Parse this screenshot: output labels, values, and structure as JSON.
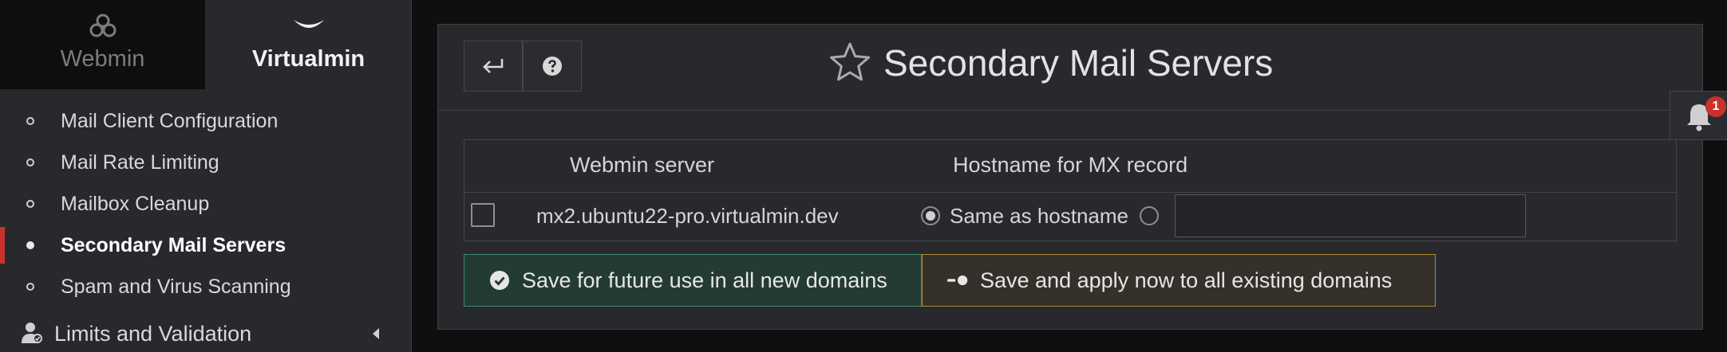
{
  "sidebar": {
    "switch": {
      "webmin": "Webmin",
      "virtualmin": "Virtualmin"
    },
    "items": [
      {
        "label": "Mail Client Configuration",
        "active": false
      },
      {
        "label": "Mail Rate Limiting",
        "active": false
      },
      {
        "label": "Mailbox Cleanup",
        "active": false
      },
      {
        "label": "Secondary Mail Servers",
        "active": true
      },
      {
        "label": "Spam and Virus Scanning",
        "active": false
      }
    ],
    "group": {
      "label": "Limits and Validation",
      "icon": "user-check-icon"
    }
  },
  "header": {
    "title": "Secondary Mail Servers",
    "back_icon": "return-arrow-icon",
    "help_icon": "question-circle-icon",
    "favorite_icon": "star-outline-icon"
  },
  "notifications": {
    "count": "1",
    "icon": "bell-icon"
  },
  "table": {
    "columns": [
      "Webmin server",
      "Hostname for MX record"
    ],
    "rows": [
      {
        "server": "mx2.ubuntu22-pro.virtualmin.dev",
        "same_as_hostname_label": "Same as hostname",
        "selected_option": "same_as_hostname",
        "custom_hostname_value": ""
      }
    ]
  },
  "actions": {
    "save_future": "Save for future use in all new domains",
    "save_apply": "Save and apply now to all existing domains"
  },
  "colors": {
    "accent_active": "#c9322c",
    "save_future_border": "#3c8a66",
    "save_apply_border": "#b48a2e",
    "badge": "#c9322c"
  }
}
